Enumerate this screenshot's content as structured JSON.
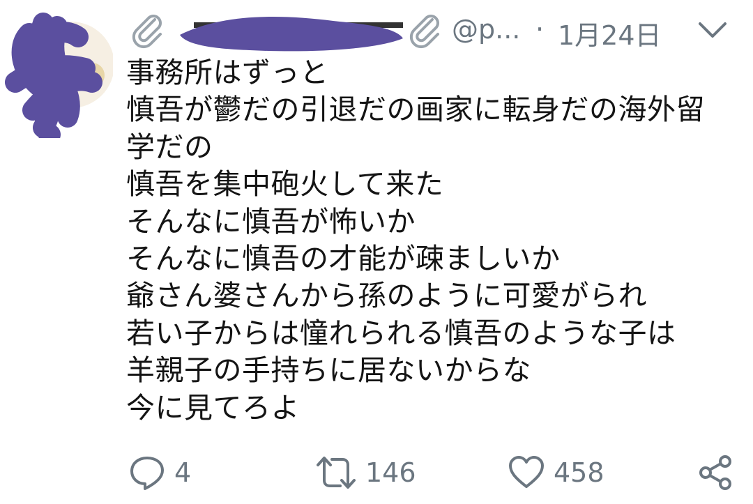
{
  "tweet": {
    "author_handle": "@p...",
    "separator": "·",
    "date": "1月24日",
    "body_lines": [
      "事務所はずっと",
      "慎吾が鬱だの引退だの画家に転身だの海外留",
      "学だの",
      "慎吾を集中砲火して来た",
      "そんなに慎吾が怖いか",
      "そんなに慎吾の才能が疎ましいか",
      "爺さん婆さんから孫のように可愛がられ",
      "若い子からは憧れられる慎吾のような子は",
      "羊親子の手持ちに居ないからな",
      "今に見てろよ"
    ]
  },
  "actions": {
    "reply_count": "4",
    "retweet_count": "146",
    "like_count": "458"
  },
  "icons": {
    "avatar": "avatar-redacted",
    "header_left": "paperclip-icon",
    "header_right": "paperclip-icon",
    "menu": "chevron-down-icon",
    "reply": "speech-bubble-icon",
    "retweet": "retweet-icon",
    "like": "heart-icon",
    "share": "share-icon"
  },
  "colors": {
    "text": "#141414",
    "muted": "#6b7680",
    "scribble": "#5b4f9f",
    "background": "#ffffff"
  }
}
